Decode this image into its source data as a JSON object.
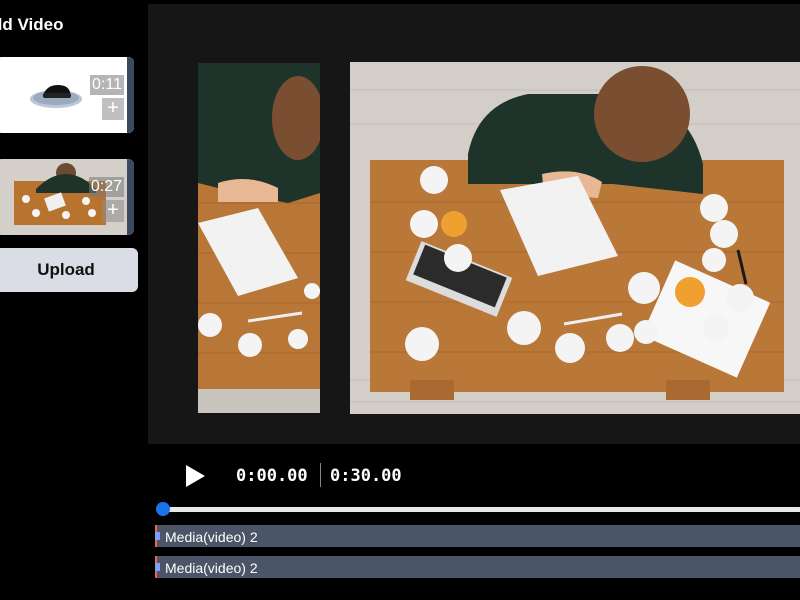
{
  "sidebar": {
    "title": "dd Video",
    "media": [
      {
        "duration": "0:11",
        "add": "+"
      },
      {
        "duration": "0:27",
        "add": "+"
      }
    ],
    "upload_label": "Upload"
  },
  "player": {
    "current_time": "0:00.00",
    "total_time": "0:30.00",
    "progress": 0
  },
  "timeline": {
    "tracks": [
      {
        "label": "Media(video) 2"
      },
      {
        "label": "Media(video) 2"
      }
    ]
  },
  "colors": {
    "accent": "#1a73e8",
    "track": "#4a5568",
    "playhead": "#ff5a4a",
    "upload_button": "#dadde6"
  }
}
